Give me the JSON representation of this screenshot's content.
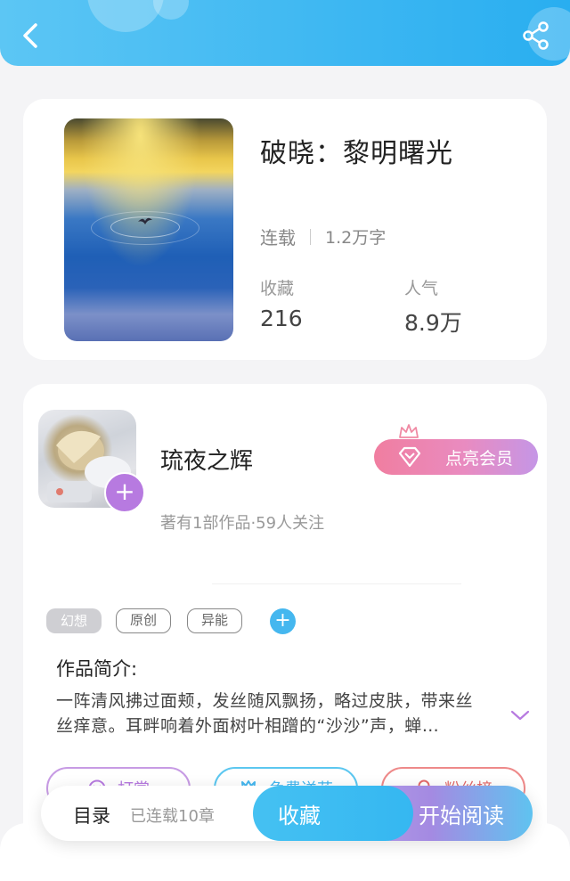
{
  "book": {
    "title": "破晓：黎明曙光",
    "status": "连载",
    "word_count": "1.2万字",
    "favorites_label": "收藏",
    "favorites_value": "216",
    "popularity_label": "人气",
    "popularity_value": "8.9万"
  },
  "author": {
    "name": "琉夜之辉",
    "meta": "著有1部作品·59人关注",
    "member_button": "点亮会员"
  },
  "tags": [
    "幻想",
    "原创",
    "异能"
  ],
  "intro": {
    "heading": "作品简介:",
    "text": "一阵清风拂过面颊，发丝随风飘扬，略过皮肤，带来丝丝痒意。耳畔响着外面树叶相蹭的“沙沙”声，蝉…"
  },
  "actions": {
    "reward": "打赏",
    "free_gift": "免费送花",
    "fans_rank": "粉丝榜"
  },
  "bottom_bar": {
    "toc": "目录",
    "chapters": "已连载10章",
    "favorite": "收藏",
    "start_reading": "开始阅读"
  },
  "colors": {
    "header_blue": "#3db7f2",
    "accent_purple": "#b77ae0",
    "member_pink": "#f07ea0"
  },
  "icons": {
    "back": "back-arrow-icon",
    "share": "share-icon",
    "diamond": "diamond-icon",
    "crown": "crown-icon",
    "expand": "chevron-down-icon"
  }
}
